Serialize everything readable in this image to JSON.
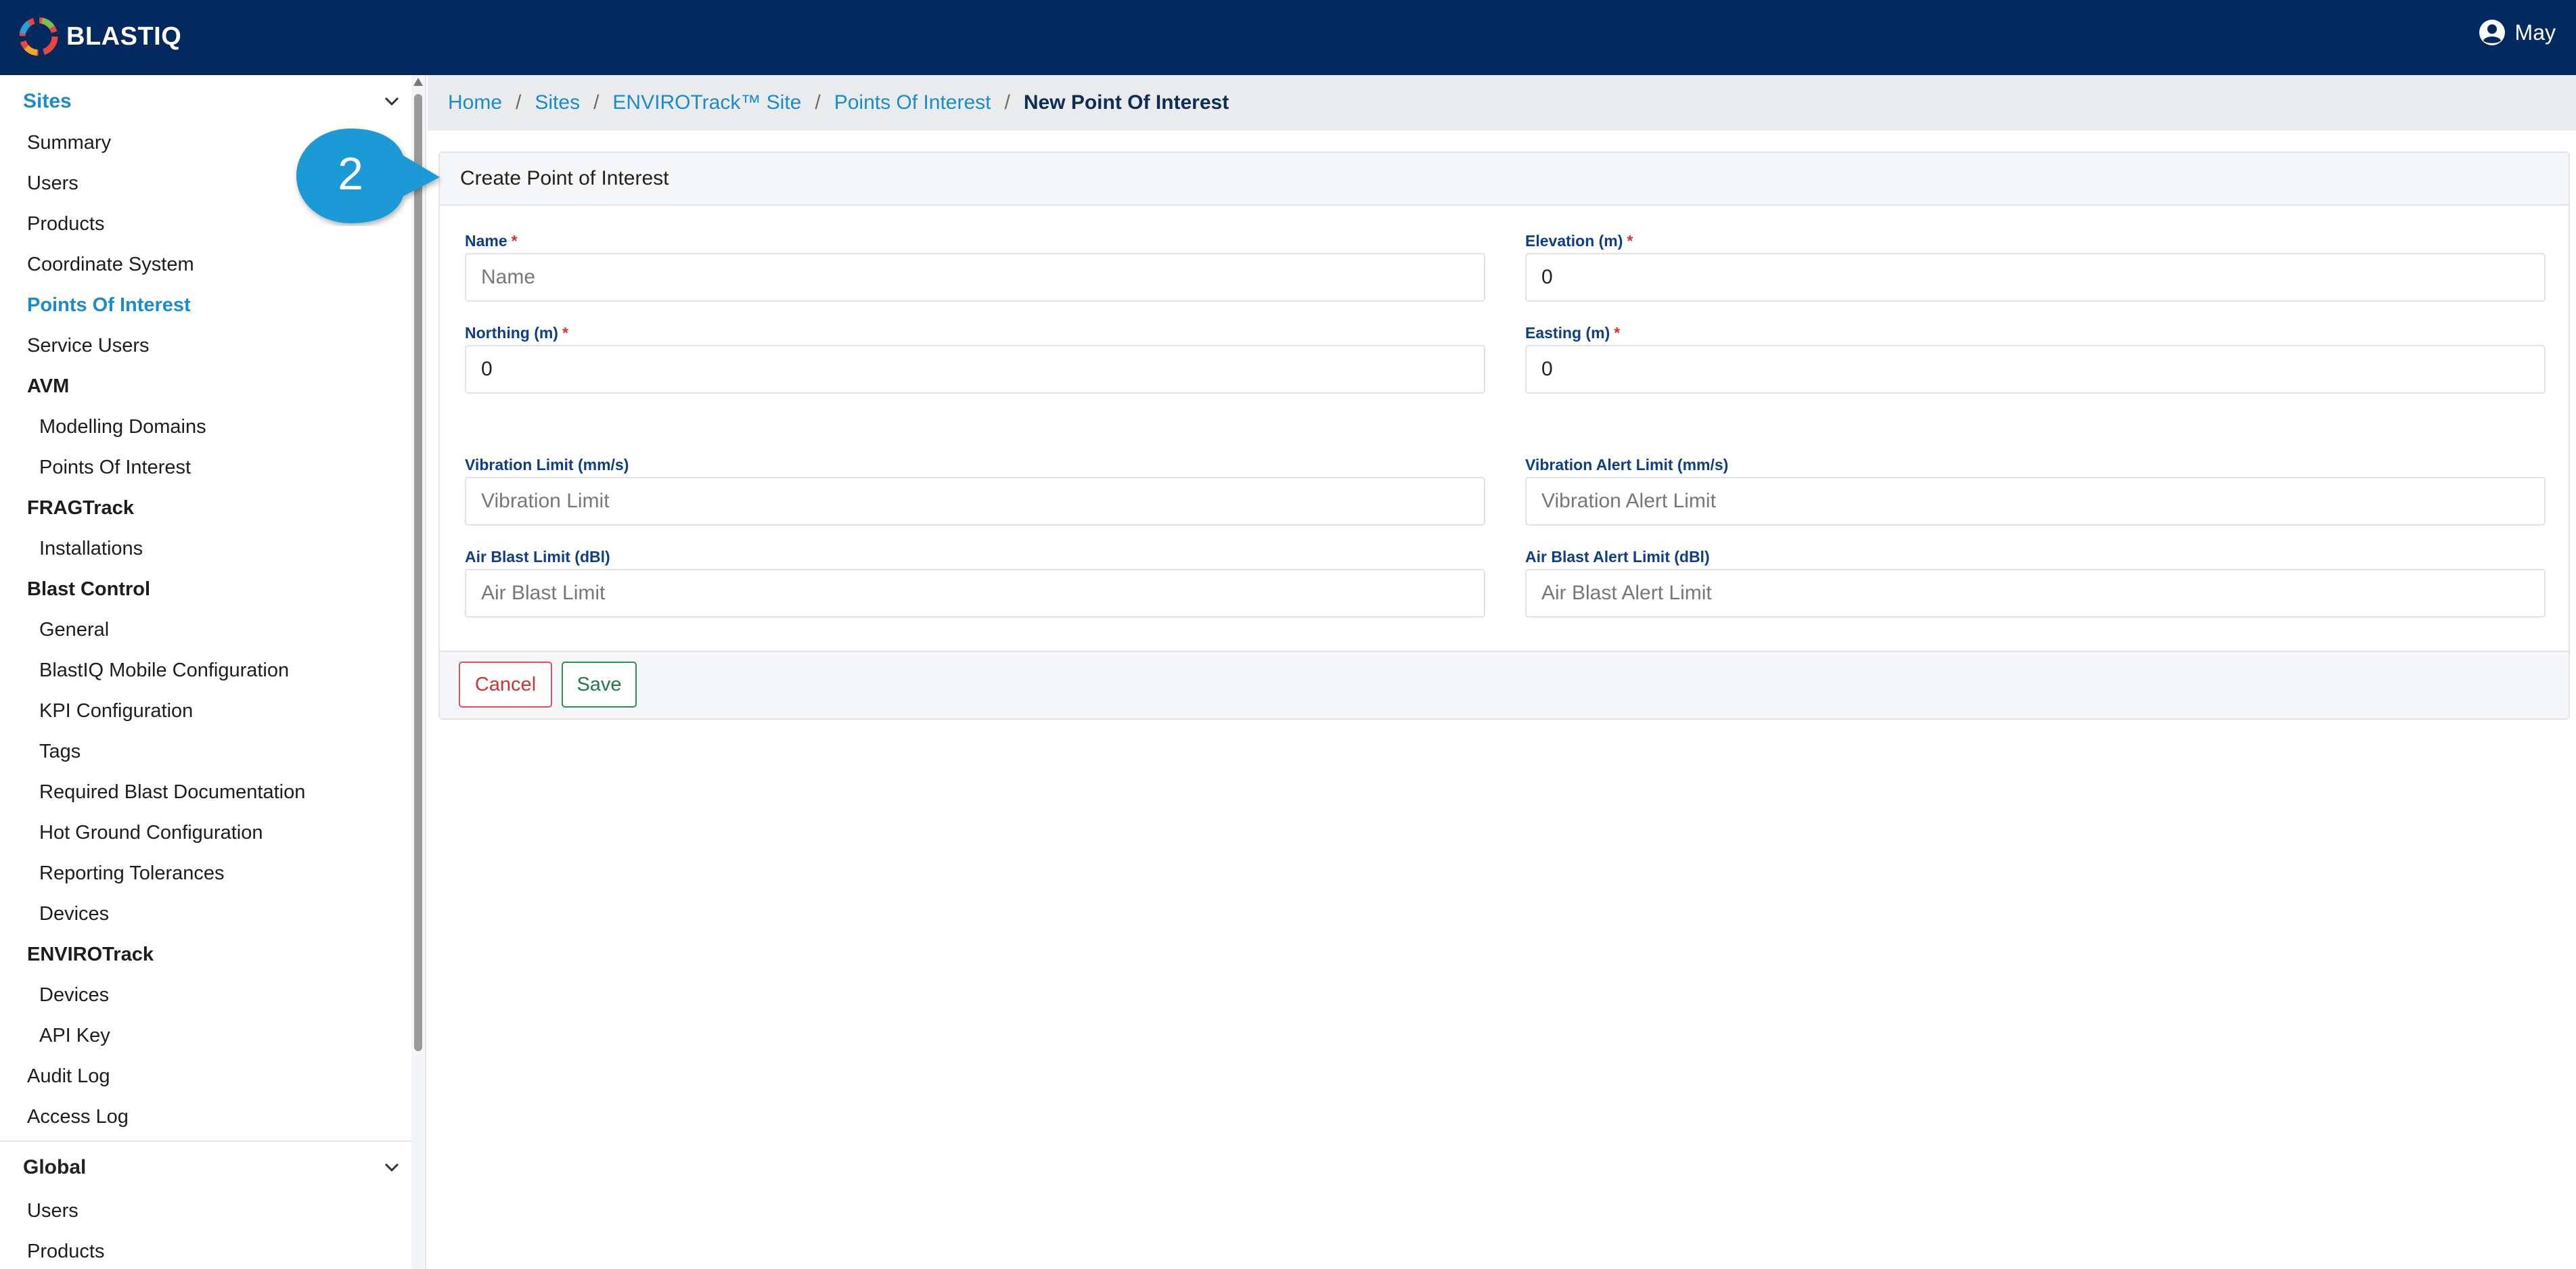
{
  "app": {
    "brand": "BLASTIQ",
    "user_name": "May"
  },
  "sidebar": {
    "sites_label": "Sites",
    "items": [
      {
        "label": "Summary"
      },
      {
        "label": "Users"
      },
      {
        "label": "Products"
      },
      {
        "label": "Coordinate System"
      },
      {
        "label": "Points Of Interest"
      },
      {
        "label": "Service Users"
      },
      {
        "label": "AVM"
      },
      {
        "label": "Modelling Domains"
      },
      {
        "label": "Points Of Interest"
      },
      {
        "label": "FRAGTrack"
      },
      {
        "label": "Installations"
      },
      {
        "label": "Blast Control"
      },
      {
        "label": "General"
      },
      {
        "label": "BlastIQ Mobile Configuration"
      },
      {
        "label": "KPI Configuration"
      },
      {
        "label": "Tags"
      },
      {
        "label": "Required Blast Documentation"
      },
      {
        "label": "Hot Ground Configuration"
      },
      {
        "label": "Reporting Tolerances"
      },
      {
        "label": "Devices"
      },
      {
        "label": "ENVIROTrack"
      },
      {
        "label": "Devices"
      },
      {
        "label": "API Key"
      },
      {
        "label": "Audit Log"
      },
      {
        "label": "Access Log"
      }
    ],
    "global_label": "Global",
    "global_items": [
      {
        "label": "Users"
      },
      {
        "label": "Products"
      }
    ]
  },
  "breadcrumb": {
    "items": [
      "Home",
      "Sites",
      "ENVIROTrack™ Site",
      "Points Of Interest"
    ],
    "separator": "/",
    "current": "New Point Of Interest"
  },
  "form": {
    "title": "Create Point of Interest",
    "required_mark": "*",
    "name": {
      "label": "Name",
      "placeholder": "Name",
      "value": ""
    },
    "elevation": {
      "label": "Elevation (m)",
      "value": "0"
    },
    "northing": {
      "label": "Northing (m)",
      "value": "0"
    },
    "easting": {
      "label": "Easting (m)",
      "value": "0"
    },
    "vibration_limit": {
      "label": "Vibration Limit (mm/s)",
      "placeholder": "Vibration Limit"
    },
    "vibration_alert_limit": {
      "label": "Vibration Alert Limit (mm/s)",
      "placeholder": "Vibration Alert Limit"
    },
    "air_blast_limit": {
      "label": "Air Blast Limit (dBl)",
      "placeholder": "Air Blast Limit"
    },
    "air_blast_alert_limit": {
      "label": "Air Blast Alert Limit (dBl)",
      "placeholder": "Air Blast Alert Limit"
    },
    "cancel_label": "Cancel",
    "save_label": "Save"
  },
  "callout": {
    "number": "2"
  },
  "colors": {
    "topbar": "#022a5e",
    "link": "#1a8ccc",
    "label": "#0d3f87",
    "required": "#d0342c",
    "save": "#227a48",
    "callout": "#1a9ad6"
  },
  "icons": [
    "blastiq-logo-icon",
    "user-circle-icon",
    "chevron-down-icon"
  ]
}
